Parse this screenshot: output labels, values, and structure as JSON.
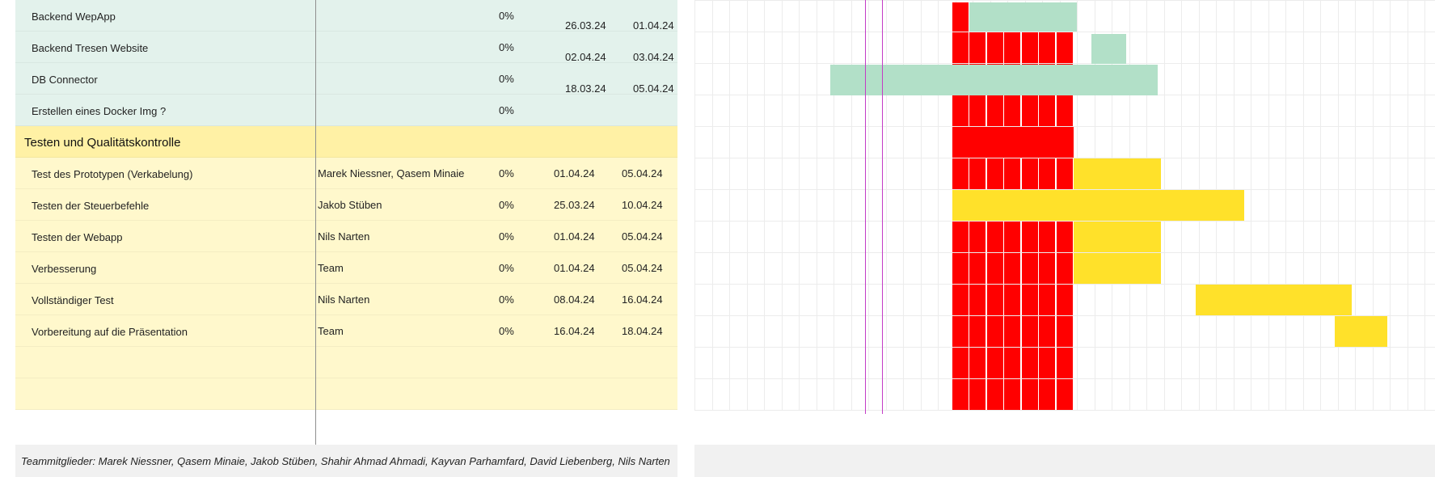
{
  "colors": {
    "green_row_bg": "#e3f2ec",
    "yellow_row_bg": "#fff8cc",
    "section_bg": "#fff1a5",
    "green_bar": "#b2e0c8",
    "yellow_bar": "#ffe12a",
    "red_block": "#ff0000",
    "today_marker": "#c33cc6",
    "grid_line": "#ececec"
  },
  "rows": [
    {
      "type": "green",
      "task": "Backend WepApp",
      "resource": "",
      "percent": "0%",
      "start": "26.03.24",
      "end": "01.04.24"
    },
    {
      "type": "green",
      "task": "Backend Tresen Website",
      "resource": "",
      "percent": "0%",
      "start": "02.04.24",
      "end": "03.04.24"
    },
    {
      "type": "green",
      "task": "DB Connector",
      "resource": "",
      "percent": "0%",
      "start": "18.03.24",
      "end": "05.04.24"
    },
    {
      "type": "green",
      "task": "Erstellen eines Docker Img ?",
      "resource": "",
      "percent": "0%",
      "start": "",
      "end": ""
    },
    {
      "type": "section",
      "task": "Testen und Qualitätskontrolle",
      "resource": "",
      "percent": "",
      "start": "",
      "end": ""
    },
    {
      "type": "yellow",
      "task": "Test des Prototypen (Verkabelung)",
      "resource": "Marek Niessner, Qasem Minaie",
      "percent": "0%",
      "start": "01.04.24",
      "end": "05.04.24"
    },
    {
      "type": "yellow",
      "task": "Testen der Steuerbefehle",
      "resource": "Jakob Stüben",
      "percent": "0%",
      "start": "25.03.24",
      "end": "10.04.24"
    },
    {
      "type": "yellow",
      "task": "Testen der Webapp",
      "resource": "Nils Narten",
      "percent": "0%",
      "start": "01.04.24",
      "end": "05.04.24"
    },
    {
      "type": "yellow",
      "task": "Verbesserung",
      "resource": "Team",
      "percent": "0%",
      "start": "01.04.24",
      "end": "05.04.24"
    },
    {
      "type": "yellow",
      "task": "Vollständiger Test",
      "resource": "Nils Narten",
      "percent": "0%",
      "start": "08.04.24",
      "end": "16.04.24"
    },
    {
      "type": "yellow",
      "task": "Vorbereitung auf die Präsentation",
      "resource": "Team",
      "percent": "0%",
      "start": "16.04.24",
      "end": "18.04.24"
    },
    {
      "type": "yellow",
      "task": "",
      "resource": "",
      "percent": "",
      "start": "",
      "end": ""
    },
    {
      "type": "yellow",
      "task": "",
      "resource": "",
      "percent": "",
      "start": "",
      "end": ""
    }
  ],
  "footer": {
    "team_members": "Teammitglieder: Marek Niessner, Qasem Minaie, Jakob Stüben, Shahir Ahmad Ahmadi, Kayvan Parhamfard, David Liebenberg, Nils Narten"
  }
}
